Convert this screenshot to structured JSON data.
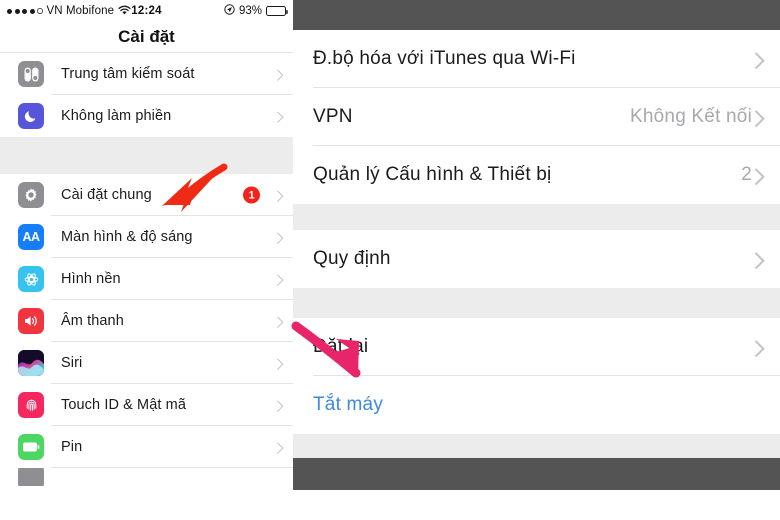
{
  "left_panel": {
    "status_bar": {
      "signal_dots": 5,
      "signal_filled": 4,
      "carrier": "VN Mobifone",
      "wifi_icon": "wifi-icon",
      "time": "12:24",
      "location_icon": "location-arrow-icon",
      "battery_percent": "93%",
      "battery_level": 93
    },
    "nav_title": "Cài đặt",
    "groups": [
      {
        "rows": [
          {
            "label": "Trung tâm kiểm soát",
            "icon": "control-center-icon",
            "icon_color": "#8e8e93",
            "chevron": true
          },
          {
            "label": "Không làm phiền",
            "icon": "moon-icon",
            "icon_color": "#5755d9",
            "chevron": true
          }
        ]
      },
      {
        "rows": [
          {
            "label": "Cài đặt chung",
            "icon": "gear-icon",
            "icon_color": "#8e8e93",
            "chevron": true,
            "badge": "1"
          },
          {
            "label": "Màn hình & độ sáng",
            "icon": "display-brightness-icon",
            "icon_color": "#167efb",
            "chevron": true
          },
          {
            "label": "Hình nền",
            "icon": "wallpaper-icon",
            "icon_color": "#36c3f0",
            "chevron": true
          },
          {
            "label": "Âm thanh",
            "icon": "speaker-icon",
            "icon_color": "#f0353f",
            "chevron": true
          },
          {
            "label": "Siri",
            "icon": "siri-icon",
            "icon_color": "#111111",
            "chevron": true
          },
          {
            "label": "Touch ID & Mật mã",
            "icon": "fingerprint-icon",
            "icon_color": "#f4285c",
            "chevron": true
          },
          {
            "label": "Pin",
            "icon": "battery-icon",
            "icon_color": "#4cd763",
            "chevron": true
          }
        ]
      }
    ]
  },
  "right_panel": {
    "groups": [
      {
        "rows": [
          {
            "label": "Đ.bộ hóa với iTunes qua Wi-Fi",
            "value": "",
            "chevron": true
          },
          {
            "label": "VPN",
            "value": "Không Kết nối",
            "chevron": true
          },
          {
            "label": "Quản lý Cấu hình & Thiết bị",
            "value": "2",
            "chevron": true
          }
        ]
      },
      {
        "rows": [
          {
            "label": "Quy định",
            "value": "",
            "chevron": true
          }
        ]
      },
      {
        "rows": [
          {
            "label": "Đặt lại",
            "value": "",
            "chevron": true
          },
          {
            "label": "Tắt máy",
            "value": "",
            "chevron": false,
            "link": true
          }
        ]
      }
    ]
  },
  "annotations": [
    {
      "name": "red-arrow-general-settings",
      "color": "#ef2b16",
      "points_to": "Cài đặt chung"
    },
    {
      "name": "pink-arrow-reset",
      "color": "#e8246a",
      "points_to": "Đặt lại"
    }
  ]
}
